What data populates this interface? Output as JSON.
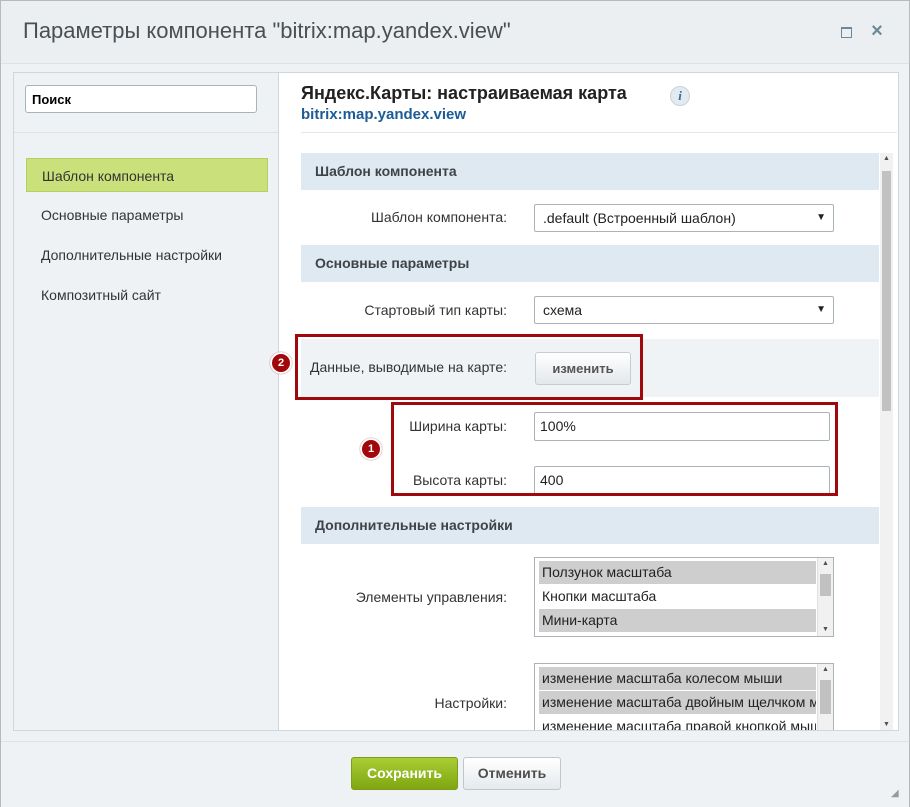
{
  "window": {
    "title": "Параметры компонента \"bitrix:map.yandex.view\"",
    "maximize_icon": "maximize-icon",
    "close_icon": "close-icon",
    "close_glyph": "×"
  },
  "sidebar": {
    "search": {
      "value": "Поиск",
      "placeholder": "Поиск"
    },
    "items": [
      {
        "label": "Шаблон компонента",
        "active": true
      },
      {
        "label": "Основные параметры",
        "active": false
      },
      {
        "label": "Дополнительные настройки",
        "active": false
      },
      {
        "label": "Композитный сайт",
        "active": false
      }
    ]
  },
  "header": {
    "component_title": "Яндекс.Карты: настраиваемая карта",
    "info_glyph": "i",
    "component_code": "bitrix:map.yandex.view"
  },
  "sections": {
    "template": {
      "title": "Шаблон компонента",
      "template_label": "Шаблон компонента:",
      "template_value": ".default (Встроенный шаблон)"
    },
    "basic": {
      "title": "Основные параметры",
      "map_type_label": "Стартовый тип карты:",
      "map_type_value": "схема",
      "data_label": "Данные, выводимые на карте:",
      "data_button": "изменить",
      "width_label": "Ширина карты:",
      "width_value": "100%",
      "height_label": "Высота карты:",
      "height_value": "400"
    },
    "extra": {
      "title": "Дополнительные настройки",
      "controls_label": "Элементы управления:",
      "controls_options": [
        {
          "label": "Ползунок масштаба",
          "selected": true
        },
        {
          "label": "Кнопки масштаба",
          "selected": false
        },
        {
          "label": "Мини-карта",
          "selected": true
        }
      ],
      "settings_label": "Настройки:",
      "settings_options": [
        {
          "label": "изменение масштаба колесом мыши",
          "selected": true
        },
        {
          "label": "изменение масштаба двойным щелчком мыши",
          "selected": true
        },
        {
          "label": "изменение масштаба правой кнопкой мыши",
          "selected": false
        }
      ]
    }
  },
  "annotations": [
    {
      "number": "1",
      "color": "#a1080c"
    },
    {
      "number": "2",
      "color": "#a1080c"
    }
  ],
  "footer": {
    "save_label": "Сохранить",
    "cancel_label": "Отменить"
  },
  "colors": {
    "accent_green": "#8db521",
    "active_nav": "#c9e07b",
    "section_bg": "#dfe9f2",
    "link_blue": "#1c5b96",
    "highlight_red": "#a1080c"
  }
}
